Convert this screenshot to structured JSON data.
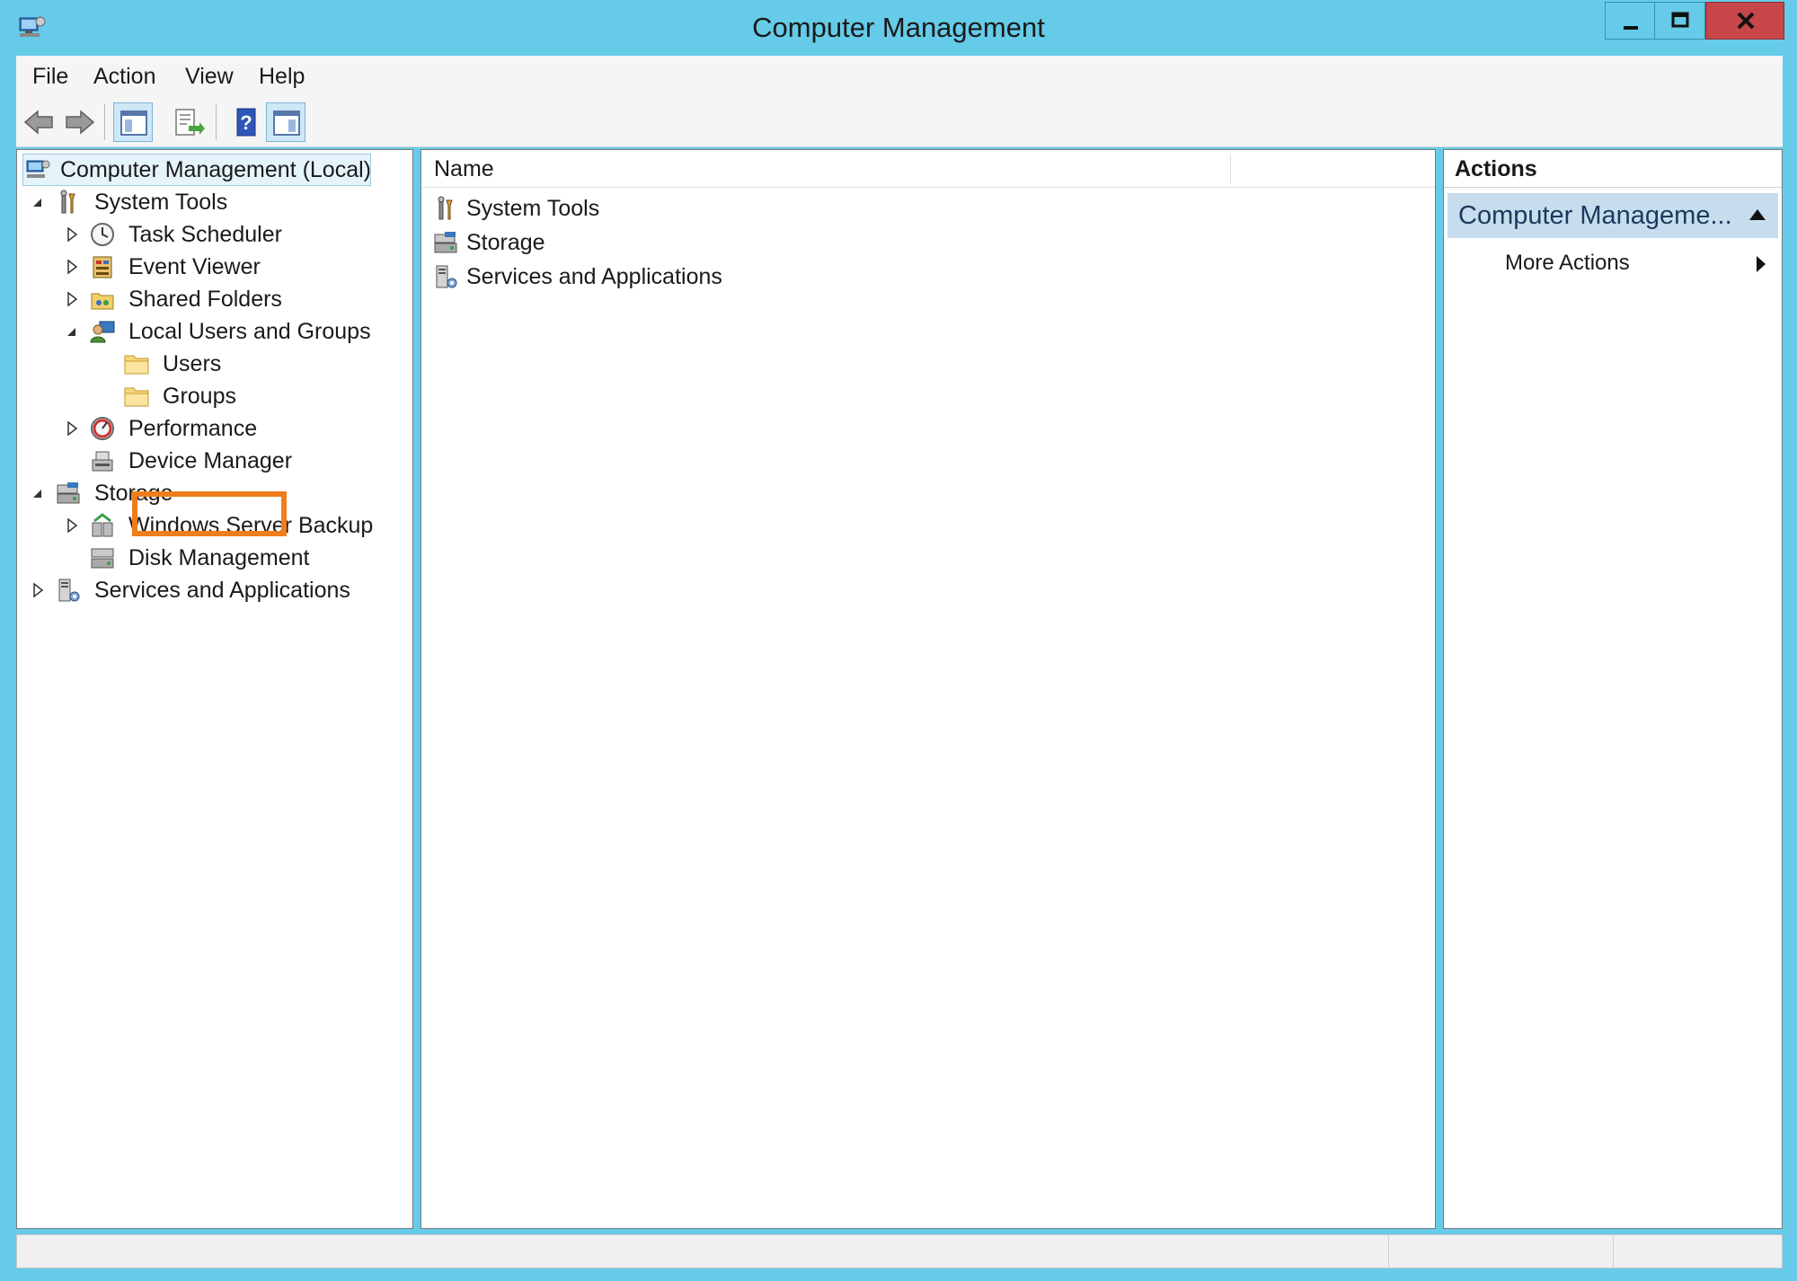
{
  "window": {
    "title": "Computer Management",
    "controls": [
      "minimize",
      "maximize",
      "close"
    ]
  },
  "menubar": {
    "items": [
      "File",
      "Action",
      "View",
      "Help"
    ]
  },
  "toolbar": {
    "buttons": [
      {
        "icon": "back-arrow-icon"
      },
      {
        "icon": "forward-arrow-icon"
      },
      {
        "icon": "show-hide-console-tree-icon"
      },
      {
        "icon": "export-list-icon"
      },
      {
        "icon": "help-icon"
      },
      {
        "icon": "show-hide-action-pane-icon"
      }
    ]
  },
  "tree": {
    "root": "Computer Management (Local)",
    "nodes": [
      {
        "label": "System Tools",
        "expanded": true
      },
      {
        "label": "Task Scheduler"
      },
      {
        "label": "Event Viewer"
      },
      {
        "label": "Shared Folders"
      },
      {
        "label": "Local Users and Groups",
        "expanded": true
      },
      {
        "label": "Users",
        "highlighted": true
      },
      {
        "label": "Groups"
      },
      {
        "label": "Performance"
      },
      {
        "label": "Device Manager"
      },
      {
        "label": "Storage",
        "expanded": true
      },
      {
        "label": "Windows Server Backup"
      },
      {
        "label": "Disk Management"
      },
      {
        "label": "Services and Applications"
      }
    ]
  },
  "list": {
    "column": "Name",
    "items": [
      "System Tools",
      "Storage",
      "Services and Applications"
    ]
  },
  "actions": {
    "title": "Actions",
    "section": "Computer Manageme...",
    "more": "More Actions"
  },
  "colors": {
    "frame": "#65cbe9",
    "highlight": "#f07d1c",
    "selection": "#e5f3fb",
    "action_section": "#c7ddee"
  }
}
